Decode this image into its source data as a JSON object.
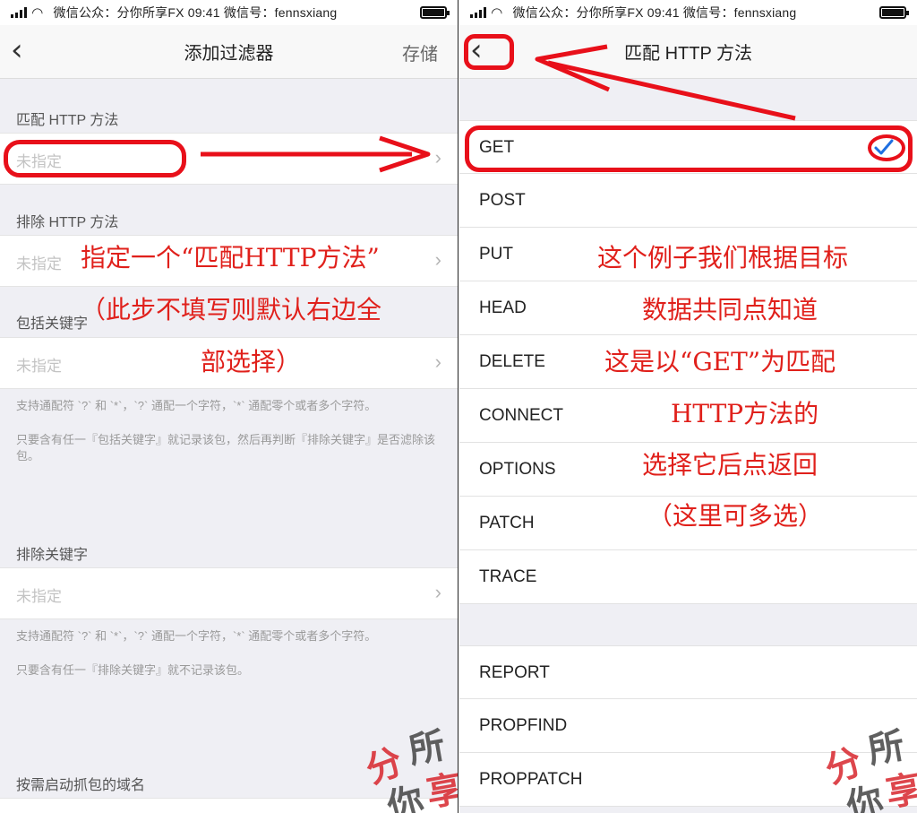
{
  "status_bar": {
    "text": "微信公众：分你所享FX  09:41  微信号：fennsxiang"
  },
  "left_screen": {
    "nav": {
      "back_icon": "chevron-left-icon",
      "title": "添加过滤器",
      "save_label": "存储"
    },
    "sections": [
      {
        "header": "匹配 HTTP 方法",
        "value_placeholder": "未指定"
      },
      {
        "header": "排除 HTTP 方法",
        "value_placeholder": "未指定"
      },
      {
        "header": "包括关键字",
        "value_placeholder": "未指定",
        "footnote_1": "支持通配符 `?` 和 `*`，`?` 通配一个字符，`*` 通配零个或者多个字符。",
        "footnote_2": "只要含有任一『包括关键字』就记录该包，然后再判断『排除关键字』是否滤除该包。"
      },
      {
        "header": "排除关键字",
        "value_placeholder": "未指定",
        "footnote_1": "支持通配符 `?` 和 `*`，`?` 通配一个字符，`*` 通配零个或者多个字符。",
        "footnote_2": "只要含有任一『排除关键字』就不记录该包。"
      },
      {
        "header": "按需启动抓包的域名"
      }
    ],
    "annotation_lines": [
      "指定一个“匹配HTTP方法”",
      "（此步不填写则默认右边全",
      "部选择）"
    ]
  },
  "right_screen": {
    "nav": {
      "back_icon": "chevron-left-icon",
      "title": "匹配 HTTP 方法"
    },
    "methods_group_1": [
      "GET",
      "POST",
      "PUT",
      "HEAD",
      "DELETE",
      "CONNECT",
      "OPTIONS",
      "PATCH",
      "TRACE"
    ],
    "methods_group_2": [
      "REPORT",
      "PROPFIND",
      "PROPPATCH"
    ],
    "selected_method": "GET",
    "annotation_lines": [
      "这个例子我们根据目标",
      "数据共同点知道",
      "这是以“GET”为匹配",
      "HTTP方法的",
      "选择它后点返回",
      "（这里可多选）"
    ]
  },
  "watermark": {
    "chars": [
      "分",
      "所",
      "你",
      "享"
    ]
  },
  "colors": {
    "annotation_red": "#e0201b",
    "check_blue": "#1f6fe0",
    "background": "#efeff4"
  }
}
